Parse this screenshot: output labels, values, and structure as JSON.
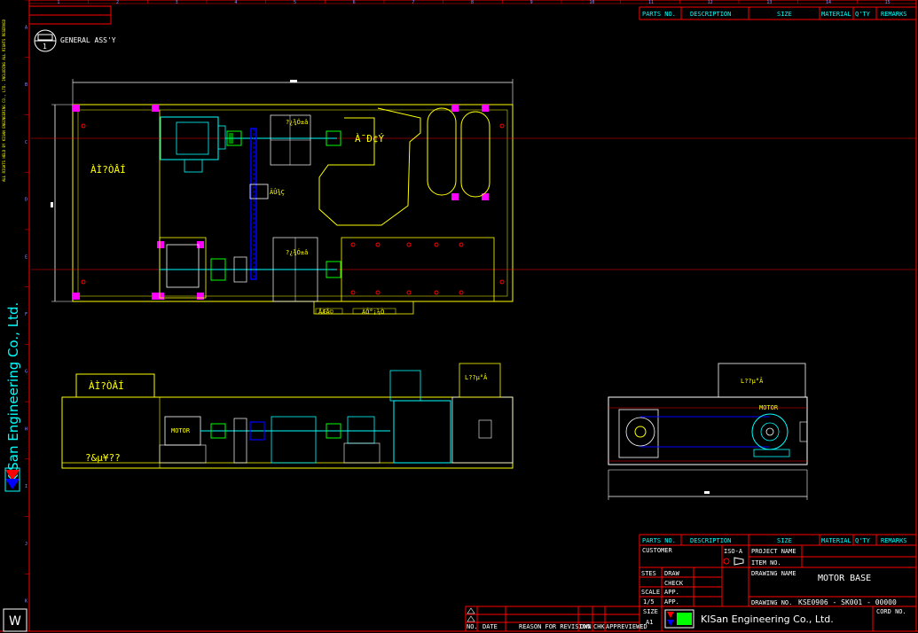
{
  "drawing": {
    "view_label": "GENERAL ASS'Y",
    "view_symbol": "1",
    "company_vertical": "KISan Engineering Co., Ltd.",
    "copyright_vertical": "ALL RIGHTS HELD BY KISAN ENGINEERING CO., LTD. INCLUDING ALL RIGHTS RESERVED",
    "motor_label_side": "MOTOR",
    "motor_label_end": "MOTOR",
    "plan_label_left": "ÀÌ?ÒÂÍ",
    "plan_label_small_1": "?¿¾Ó±â",
    "plan_label_small_2": "?¿¾Ó±â",
    "plan_label_coupling": "ÄÛ¾Ç",
    "plan_label_bottom_1": "ÅÆÅ©",
    "plan_label_bottom_2": "ÀÔ°¡¼Ò",
    "plan_label_tank": "À¯Ð¢Ý",
    "side_label_top": "ÀÌ?ÒÂÍ",
    "side_label_bottom": "?&µ¥??",
    "side_label_right": "L??µ°Â",
    "end_label_top": "L??µ°Â",
    "corner_letter": "W"
  },
  "title_block_top": {
    "headers": [
      "PARTS NO.",
      "DESCRIPTION",
      "SIZE",
      "MATERIAL",
      "Q'TY",
      "REMARKS"
    ]
  },
  "title_block": {
    "headers": [
      "PARTS NO.",
      "DESCRIPTION",
      "SIZE",
      "MATERIAL",
      "Q'TY",
      "REMARKS"
    ],
    "customer_label": "CUSTOMER",
    "iso_label": "ISO-A",
    "project_label": "PROJECT NAME",
    "item_label": "ITEM NO.",
    "drawing_name_label": "DRAWING NAME",
    "drawing_name": "MOTOR BASE",
    "drawing_no_label": "DRAWING NO.",
    "drawing_no": "KSE0906 - SK001 - 00000",
    "stes_label": "STES",
    "draw_label": "DRAW",
    "check_label": "CHECK",
    "scale_label": "SCALE",
    "app_label": "APP.",
    "scale_value": "1/5",
    "app2_label": "APP.",
    "size_label": "SIZE",
    "size_value": "A1",
    "company": "KISan Engineering Co., Ltd.",
    "cord_no_label": "CORD NO."
  },
  "revision_block": {
    "headers": [
      "NO.",
      "DATE",
      "REASON FOR REVISION",
      "DWN",
      "CHK",
      "APP",
      "REVIEWED"
    ]
  },
  "ruler_numbers": [
    "1",
    "2",
    "3",
    "4",
    "5",
    "6",
    "7",
    "8",
    "9",
    "10",
    "11",
    "12",
    "13",
    "14",
    "15"
  ],
  "ruler_letters": [
    "A",
    "B",
    "C",
    "D",
    "E",
    "F",
    "G",
    "H",
    "I",
    "J",
    "K"
  ],
  "colors": {
    "background": "#000000",
    "frame": "#ff0000",
    "outline": "#ffff00",
    "hidden": "#0000ff",
    "dimension": "#ffffff",
    "center": "#ff0000",
    "magenta": "#ff00ff",
    "green": "#00ff00",
    "cyan": "#00ffff"
  }
}
